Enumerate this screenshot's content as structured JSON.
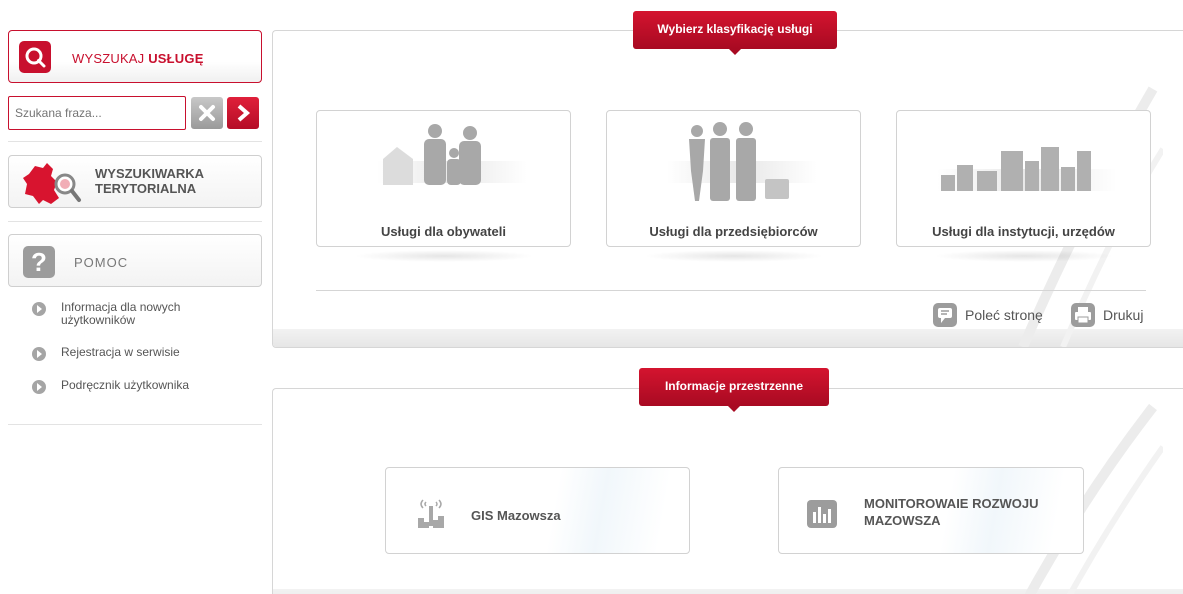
{
  "sidebar": {
    "search_label_normal": "WYSZUKAJ ",
    "search_label_bold": "USŁUGĘ",
    "search_placeholder": "Szukana fraza...",
    "territorial_line1": "WYSZUKIWARKA",
    "territorial_line2": "TERYTORIALNA",
    "help_label": "POMOC",
    "help_links": [
      {
        "label": "Informacja dla nowych użytkowników"
      },
      {
        "label": "Rejestracja w serwisie"
      },
      {
        "label": "Podręcznik użytkownika"
      }
    ]
  },
  "main": {
    "classification": {
      "tab_label": "Wybierz klasyfikację usługi",
      "cards": [
        {
          "title": "Usługi dla obywateli",
          "icon": "family-icon"
        },
        {
          "title": "Usługi dla przedsiębiorców",
          "icon": "business-people-icon"
        },
        {
          "title": "Usługi dla instytucji, urzędów",
          "icon": "city-buildings-icon"
        }
      ],
      "actions": {
        "recommend": "Poleć stronę",
        "print": "Drukuj"
      }
    },
    "spatial": {
      "tab_label": "Informacje przestrzenne",
      "cards": [
        {
          "title": "GIS Mazowsza",
          "icon": "antenna-icon"
        },
        {
          "title_line1": "MONITOROWAIE ROZWOJU",
          "title_line2": "MAZOWSZA",
          "icon": "bar-chart-icon"
        }
      ]
    }
  },
  "colors": {
    "brand_red": "#c8102e",
    "gray_icon": "#9c9c9c"
  }
}
